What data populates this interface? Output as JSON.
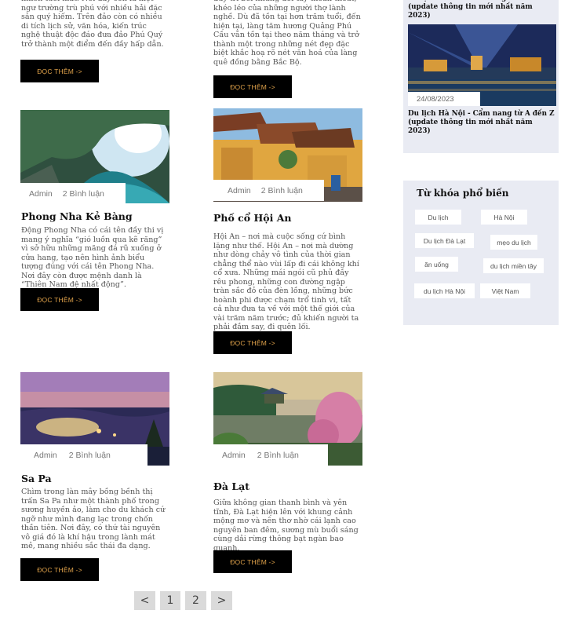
{
  "top_fragments": {
    "col1": "nhiên tươi mát. Nơi đây còn là một ngư trường trù phú với nhiều hải đặc sản quý hiếm. Trên đảo còn có nhiều di tích lịch sử, văn hóa, kiến trúc nghệ thuật độc đáo đưa đảo Phú Quý trở thành một điểm đến đầy hấp dẫn.",
    "col2": "duy trì bởi những đôi tay thoăn thoắt, khéo léo của những người thợ lành nghề. Dù đã tồn tại hơn trăm tuổi, đến hiện tại, làng tăm hương Quảng Phú Cầu vẫn tồn tại theo năm tháng và trở thành một trong những nét đẹp đặc biệt khắc hoạ rõ nét văn hoá của làng quê đồng bằng Bắc Bộ."
  },
  "read_more_label": "ĐỌC THÊM ->",
  "posts": [
    {
      "title": "Phong Nha Kẻ Bàng",
      "author": "Admin",
      "comments": "2 Bình luận",
      "excerpt": "Động Phong Nha có cái tên đầy thi vị mang ý nghĩa “gió luồn qua kẽ răng” vì sở hữu những măng đá rũ xuống ở cửa hang, tạo nên hình ảnh biểu tượng đúng với cái tên Phong Nha. Nơi đây còn được mệnh danh là “Thiên Nam đệ nhất động”."
    },
    {
      "title": "Phố cổ Hội An",
      "author": "Admin",
      "comments": "2 Bình luận",
      "excerpt": "Hội An – nơi mà cuộc sống cứ bình lặng như thế. Hội An – nơi mà dường như dòng chảy vô tình của thời gian chẳng thể nào vùi lấp đi cái không khí cổ xưa. Những mái ngói cũ phủ đầy rêu phong, những con đường ngập tràn sắc đỏ của đèn lồng, những bức hoành phi được chạm trổ tinh vi, tất cả như đưa ta về với một thế giới của vài trăm năm trước; đủ khiến người ta phải đắm say, đi quên lối."
    },
    {
      "title": "Sa Pa",
      "author": "Admin",
      "comments": "2 Bình luận",
      "excerpt": "Chìm trong làn mây bồng bềnh thị trấn Sa Pa như một thành phố trong sương huyền ảo, làm cho du khách cứ ngỡ như mình đang lạc trong chốn thần tiên. Nơi đây, có thứ tài nguyên vô giá đó là khí hậu trong lành mát mẻ, mang nhiều sắc thái đa dạng."
    },
    {
      "title": "Đà Lạt",
      "author": "Admin",
      "comments": "2 Bình luận",
      "excerpt": "Giữa không gian thanh bình và yên tĩnh, Đà Lạt hiện lên với khung cảnh mộng mơ và nên thơ nhờ cái lạnh cao nguyên ban đêm, sương mù buổi sáng cùng dải rừng thông bạt ngàn bao quanh."
    }
  ],
  "sidebar": {
    "recent": [
      {
        "title": "Du lịch Sa Pa - Cẩm nang từ A đến Z (update thông tin mới nhất năm 2023)"
      },
      {
        "title": "Du lịch Hà Nội - Cẩm nang từ A đến Z (update thông tin mới nhất năm 2023)",
        "date": "24/08/2023"
      }
    ],
    "tags_heading": "Từ khóa phổ biến",
    "tags": [
      "Du lịch",
      "Hà Nội",
      "Du lịch Đà Lạt",
      "mẹo du lịch",
      "ăn uống",
      "du lịch miền tây",
      "du lịch Hà Nội",
      "Việt Nam"
    ]
  },
  "pagination": {
    "prev": "<",
    "pages": [
      "1",
      "2"
    ],
    "next": ">"
  },
  "colors": {
    "button_bg": "#000000",
    "button_text": "#e0a24a",
    "sidebar_bg": "#e9ebf3"
  }
}
